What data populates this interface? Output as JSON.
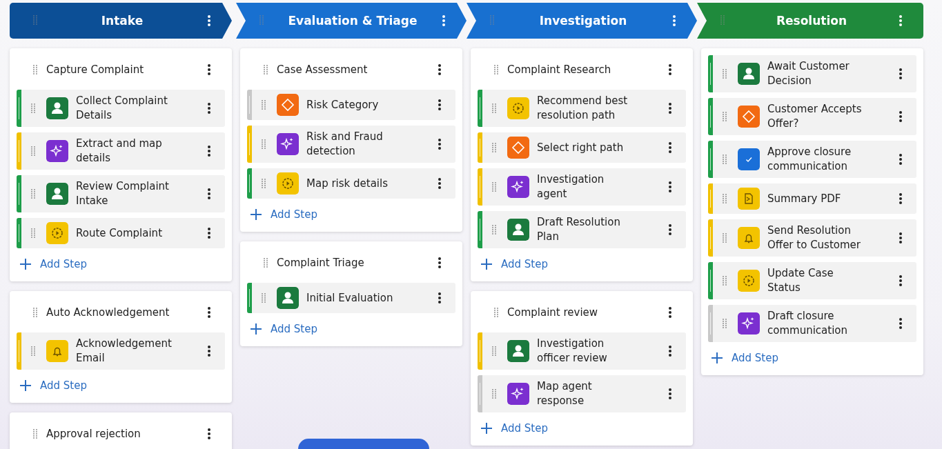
{
  "stages": [
    {
      "title": "Intake",
      "color": "#0c4f96",
      "cards": [
        {
          "title": "Capture Complaint",
          "add_label": "Add Step",
          "steps": [
            {
              "label": "Collect Complaint Details",
              "kind": "person",
              "color": "#1e9e4a"
            },
            {
              "label": "Extract and map details",
              "kind": "agent",
              "color": "#f0c000"
            },
            {
              "label": "Review Complaint Intake",
              "kind": "person",
              "color": "#1e9e4a"
            },
            {
              "label": "Route Complaint",
              "kind": "automation",
              "color": "#1e9e4a"
            }
          ]
        },
        {
          "title": "Auto Acknowledgement",
          "add_label": "Add Step",
          "steps": [
            {
              "label": "Acknowledgement Email",
              "kind": "notify",
              "color": "#f0c000"
            }
          ]
        },
        {
          "title": "Approval rejection"
        }
      ]
    },
    {
      "title": "Evaluation & Triage",
      "color": "#1870d0",
      "cards": [
        {
          "title": "Case Assessment",
          "add_label": "Add Step",
          "steps": [
            {
              "label": "Risk Category",
              "kind": "decision",
              "color": "#c8c8c8"
            },
            {
              "label": "Risk and Fraud detection",
              "kind": "agent",
              "color": "#f0c000"
            },
            {
              "label": "Map risk details",
              "kind": "automation",
              "color": "#1e9e4a"
            }
          ]
        },
        {
          "title": "Complaint Triage",
          "add_label": "Add Step",
          "steps": [
            {
              "label": "Initial Evaluation",
              "kind": "person",
              "color": "#1e9e4a"
            }
          ]
        }
      ]
    },
    {
      "title": "Investigation",
      "color": "#1870d0",
      "cards": [
        {
          "title": "Complaint Research",
          "add_label": "Add Step",
          "steps": [
            {
              "label": "Recommend best resolution path",
              "kind": "automation",
              "color": "#1e9e4a"
            },
            {
              "label": "Select right path",
              "kind": "decision",
              "color": "#f0c000"
            },
            {
              "label": "Investigation agent",
              "kind": "agent",
              "color": "#f0c000"
            },
            {
              "label": "Draft Resolution Plan",
              "kind": "person",
              "color": "#1e9e4a"
            }
          ]
        },
        {
          "title": "Complaint review",
          "add_label": "Add Step",
          "steps": [
            {
              "label": "Investigation officer review",
              "kind": "person",
              "color": "#f0c000"
            },
            {
              "label": "Map agent response",
              "kind": "agent",
              "color": "#c8c8c8"
            }
          ]
        }
      ]
    },
    {
      "title": "Resolution",
      "color": "#1f8a3c",
      "cards": [
        {
          "add_label": "Add Step",
          "steps": [
            {
              "label": "Await Customer Decision",
              "kind": "person",
              "color": "#1e9e4a"
            },
            {
              "label": "Customer Accepts Offer?",
              "kind": "decision",
              "color": "#1e9e4a"
            },
            {
              "label": "Approve closure communication",
              "kind": "approve",
              "color": "#1e9e4a"
            },
            {
              "label": "Summary PDF",
              "kind": "pdf",
              "color": "#f0c000"
            },
            {
              "label": "Send Resolution Offer to Customer",
              "kind": "notify",
              "color": "#f0c000"
            },
            {
              "label": "Update Case Status",
              "kind": "automation",
              "color": "#1e9e4a"
            },
            {
              "label": "Draft closure communication",
              "kind": "agent",
              "color": "#c8c8c8"
            }
          ]
        }
      ]
    }
  ]
}
